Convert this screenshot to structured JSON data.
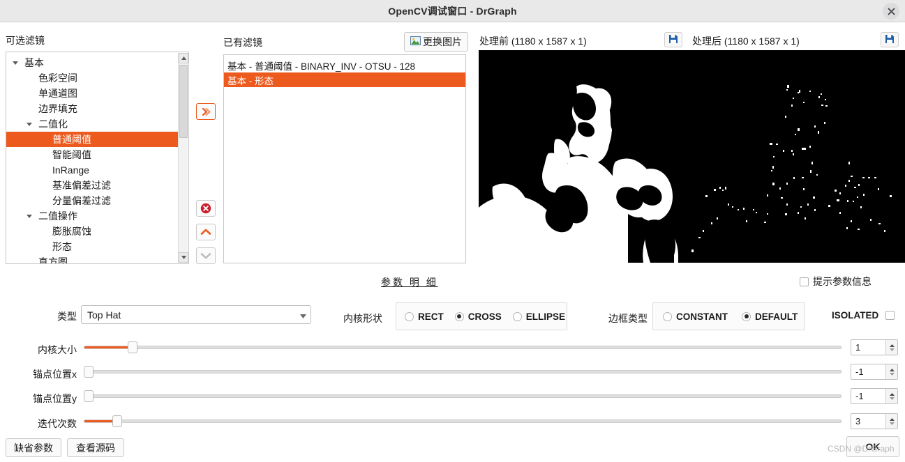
{
  "window": {
    "title": "OpenCV调试窗口 - DrGraph",
    "close_icon": "close-icon"
  },
  "left_panel": {
    "caption": "可选滤镜",
    "tree": [
      {
        "label": "基本",
        "depth": 0,
        "expander": "down",
        "selected": false
      },
      {
        "label": "色彩空间",
        "depth": 1,
        "expander": "none",
        "selected": false
      },
      {
        "label": "单通道图",
        "depth": 1,
        "expander": "none",
        "selected": false
      },
      {
        "label": "边界填充",
        "depth": 1,
        "expander": "none",
        "selected": false
      },
      {
        "label": "二值化",
        "depth": 1,
        "expander": "down",
        "selected": false
      },
      {
        "label": "普通阈值",
        "depth": 2,
        "expander": "none",
        "selected": true
      },
      {
        "label": "智能阈值",
        "depth": 2,
        "expander": "none",
        "selected": false
      },
      {
        "label": "InRange",
        "depth": 2,
        "expander": "none",
        "selected": false
      },
      {
        "label": "基准偏差过滤",
        "depth": 2,
        "expander": "none",
        "selected": false
      },
      {
        "label": "分量偏差过滤",
        "depth": 2,
        "expander": "none",
        "selected": false
      },
      {
        "label": "二值操作",
        "depth": 1,
        "expander": "down",
        "selected": false
      },
      {
        "label": "膨胀腐蚀",
        "depth": 2,
        "expander": "none",
        "selected": false
      },
      {
        "label": "形态",
        "depth": 2,
        "expander": "none",
        "selected": false
      },
      {
        "label": "直方图",
        "depth": 1,
        "expander": "none",
        "selected": false
      }
    ]
  },
  "filter_panel": {
    "caption": "已有滤镜",
    "change_image_label": "更换图片",
    "change_image_icon": "image-icon",
    "items": [
      {
        "label": "基本 - 普通阈值 - BINARY_INV - OTSU - 128",
        "selected": false
      },
      {
        "label": "基本 - 形态",
        "selected": true
      }
    ],
    "buttons": [
      {
        "name": "add-filter-button",
        "icon": "chevron-right-double-icon",
        "style": "accent"
      },
      {
        "name": "delete-filter-button",
        "icon": "delete-circle-icon",
        "style": "plain"
      },
      {
        "name": "move-up-button",
        "icon": "chevron-up-icon",
        "style": "plain"
      },
      {
        "name": "move-down-button",
        "icon": "chevron-down-icon",
        "style": "plain"
      }
    ]
  },
  "preview": {
    "before": {
      "title": "处理前 (1180 x 1587 x 1)",
      "save_icon": "save-floppy-icon"
    },
    "after": {
      "title": "处理后 (1180 x 1587 x 1)",
      "save_icon": "save-floppy-icon"
    }
  },
  "params": {
    "detail_link": "参数 明 细",
    "hint_checkbox": {
      "label": "提示参数信息",
      "checked": false
    },
    "type": {
      "label": "类型",
      "value": "Top Hat",
      "chevron_icon": "chevron-down-icon"
    },
    "kernel_shape": {
      "label": "内核形状",
      "options": [
        "RECT",
        "CROSS",
        "ELLIPSE"
      ],
      "selected": "CROSS"
    },
    "border_type": {
      "label": "边框类型",
      "options": [
        "CONSTANT",
        "DEFAULT"
      ],
      "selected": "DEFAULT"
    },
    "isolated": {
      "label": "ISOLATED",
      "checked": false
    },
    "sliders": [
      {
        "label": "内核大小",
        "value": "1",
        "percent": 6
      },
      {
        "label": "锚点位置x",
        "value": "-1",
        "percent": 0
      },
      {
        "label": "锚点位置y",
        "value": "-1",
        "percent": 0
      },
      {
        "label": "迭代次数",
        "value": "3",
        "percent": 4
      }
    ]
  },
  "footer": {
    "default_params_label": "缺省参数",
    "view_source_label": "查看源码",
    "ok_label": "OK",
    "watermark": "CSDN @DrGraph"
  },
  "colors": {
    "accent": "#ec5a1e",
    "titlebar": "#e9e9ea",
    "save_icon": "#1f5fa8",
    "delete_icon": "#cc1f2e"
  }
}
